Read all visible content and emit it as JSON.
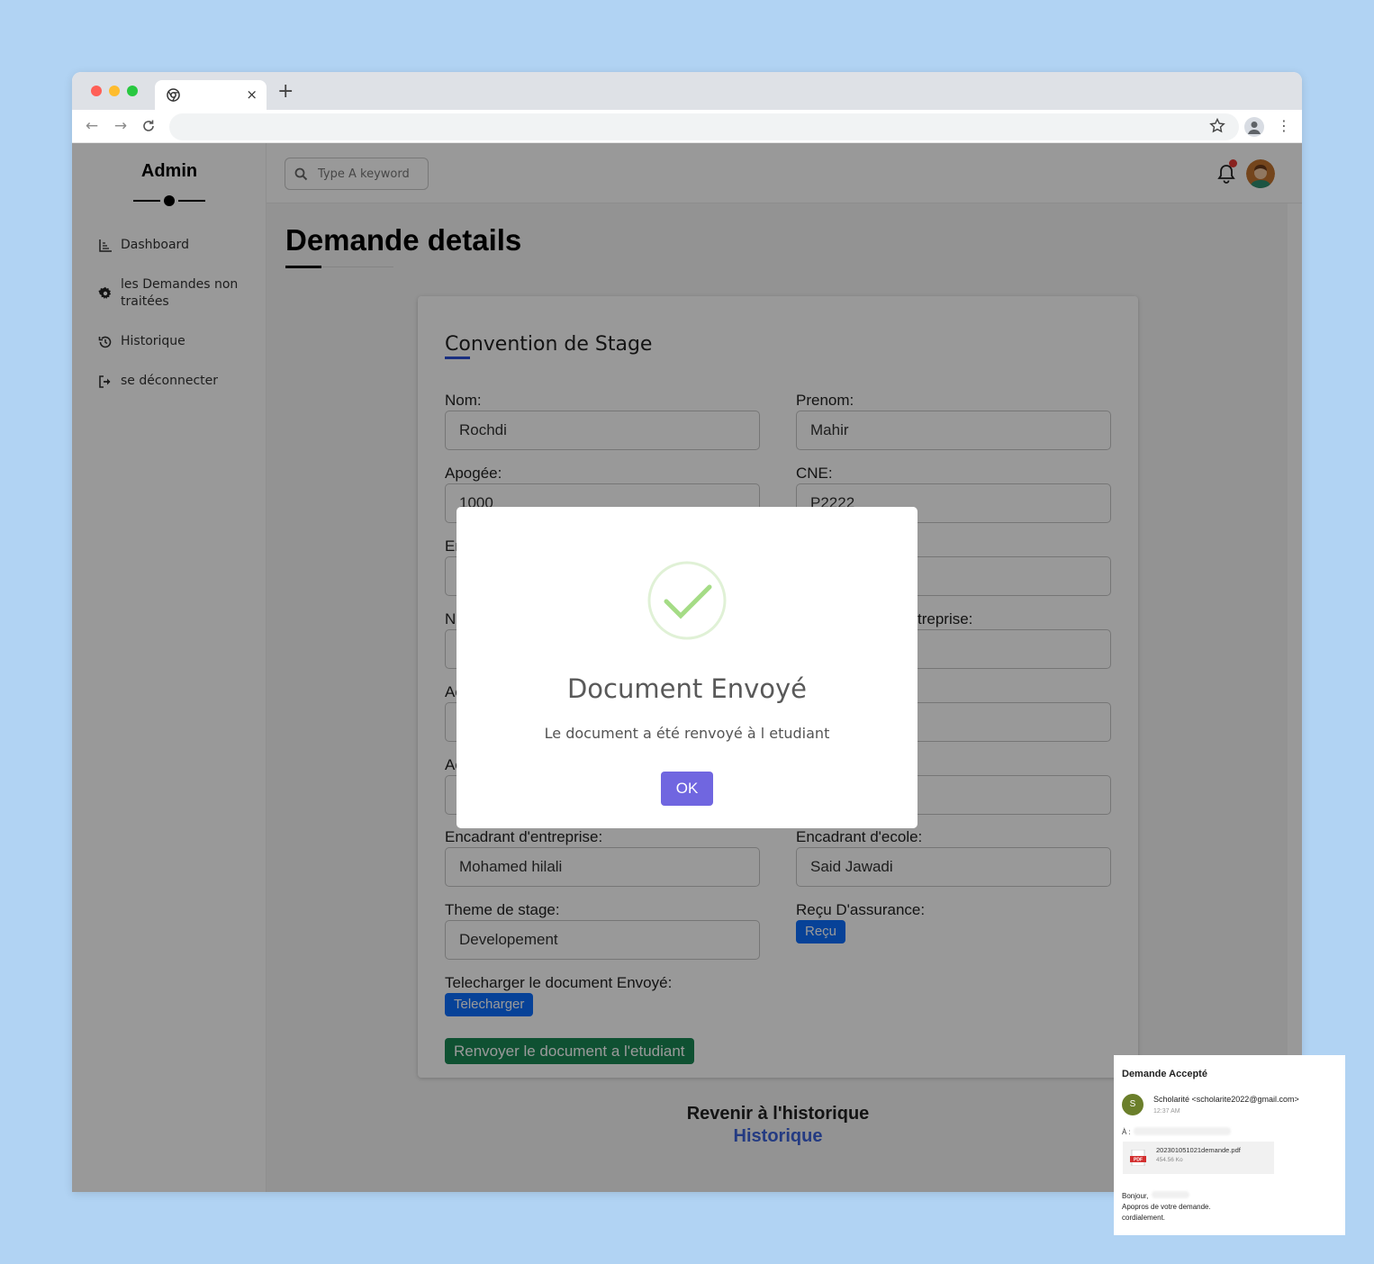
{
  "browser": {
    "tab_close": "×",
    "new_tab": "+",
    "menu": "⋮"
  },
  "sidebar": {
    "brand": "Admin",
    "items": [
      {
        "label": "Dashboard",
        "icon": "chart-icon"
      },
      {
        "label": "les Demandes non traitées",
        "icon": "gear-icon"
      },
      {
        "label": "Historique",
        "icon": "history-icon"
      },
      {
        "label": "se déconnecter",
        "icon": "logout-icon"
      }
    ]
  },
  "topbar": {
    "search_placeholder": "Type A keyword",
    "notification_badge_color": "#e53935"
  },
  "main": {
    "title": "Demande details",
    "card": {
      "title": "Convention de Stage",
      "fields": [
        {
          "label": "Nom:",
          "value": "Rochdi"
        },
        {
          "label": "Prenom:",
          "value": "Mahir"
        },
        {
          "label": "Apogée:",
          "value": "1000"
        },
        {
          "label": "CNE:",
          "value": "P2222"
        },
        {
          "label": "En",
          "value": ""
        },
        {
          "label": "",
          "value": ""
        },
        {
          "label": "N",
          "value": ""
        },
        {
          "label": "treprise:",
          "value": ""
        },
        {
          "label": "Ac",
          "value": ""
        },
        {
          "label": "",
          "value": ""
        },
        {
          "label": "Ac",
          "value": ""
        },
        {
          "label": "",
          "value": ""
        },
        {
          "label": "Encadrant d'entreprise:",
          "value": "Mohamed hilali"
        },
        {
          "label": "Encadrant d'ecole:",
          "value": "Said Jawadi"
        },
        {
          "label": "Theme de stage:",
          "value": "Developement"
        }
      ],
      "receipt_label": "Reçu D'assurance:",
      "receipt_button": "Reçu",
      "download_label": "Telecharger le document Envoyé:",
      "download_button": "Telecharger",
      "resend_button": "Renvoyer le document a l'etudiant"
    },
    "back_label": "Revenir à l'historique",
    "back_link": "Historique"
  },
  "modal": {
    "title": "Document Envoyé",
    "text": "Le document a été renvoyé à l etudiant",
    "ok": "OK",
    "ok_color": "#7066e0",
    "icon": "success-check-icon"
  },
  "email": {
    "subject": "Demande Accepté",
    "avatar_letter": "S",
    "sender": "Scholarité <scholarite2022@gmail.com>",
    "time": "12:37 AM",
    "to_label": "À :",
    "attachment_name": "202301051021demande.pdf",
    "attachment_size": "454.56 Ko",
    "pdf_badge": "PDF",
    "body_lines": [
      "Bonjour,",
      "Apopros de votre demande.",
      "cordialement."
    ]
  }
}
